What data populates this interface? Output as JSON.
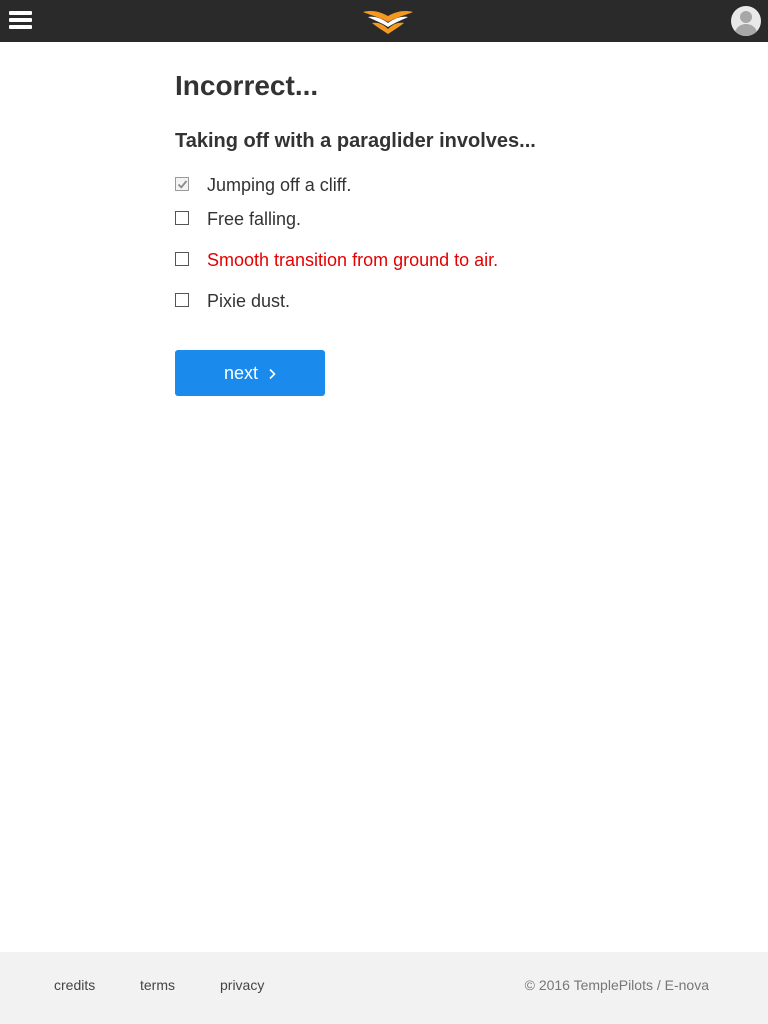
{
  "header": {
    "menu_icon": "hamburger-menu-icon",
    "logo_icon": "templepilots-wings-logo",
    "avatar_icon": "user-avatar-icon",
    "bar_color": "#2a2a2a",
    "logo_colors": [
      "#f39a1e",
      "#ffffff"
    ]
  },
  "quiz": {
    "result_title": "Incorrect...",
    "question": "Taking off with a paraglider involves...",
    "options": [
      {
        "label": "Jumping off a cliff.",
        "checked": true,
        "is_correct_answer": false
      },
      {
        "label": "Free falling.",
        "checked": false,
        "is_correct_answer": false
      },
      {
        "label": "Smooth transition from ground to air.",
        "checked": false,
        "is_correct_answer": true
      },
      {
        "label": "Pixie dust.",
        "checked": false,
        "is_correct_answer": false
      }
    ],
    "correct_answer_color": "#e60000",
    "next_label": "next",
    "next_icon": "chevron-right-icon",
    "next_color": "#1a8bec"
  },
  "footer": {
    "links": [
      "credits",
      "terms",
      "privacy"
    ],
    "copyright": "© 2016 TemplePilots / E-nova"
  }
}
